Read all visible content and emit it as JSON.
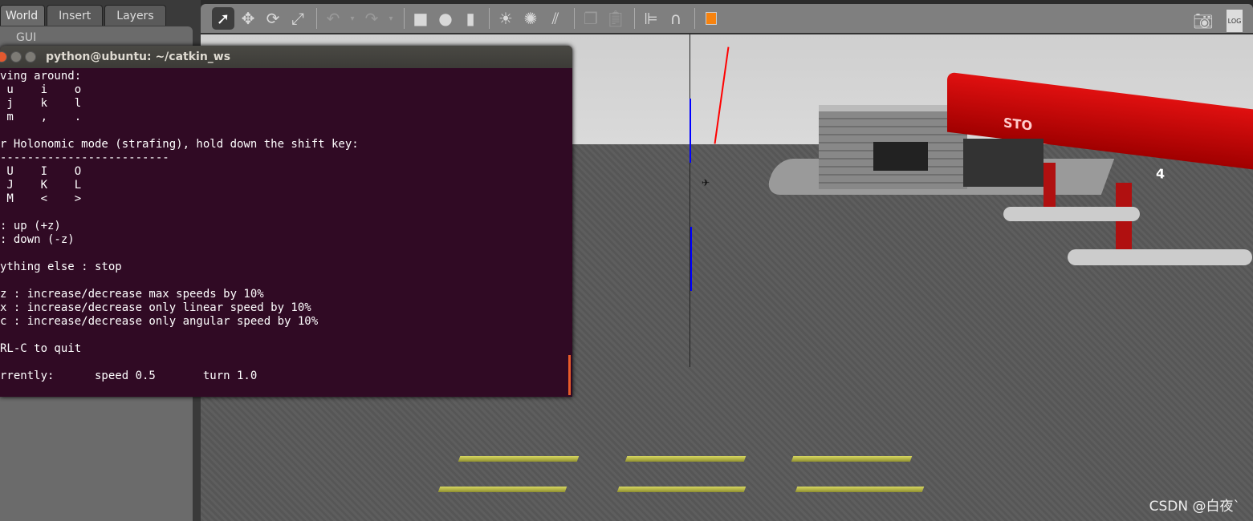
{
  "left_panel": {
    "tabs": [
      "World",
      "Insert",
      "Layers"
    ],
    "active_tab": "World",
    "items": [
      "GUI"
    ]
  },
  "toolbar": {
    "icons": [
      "select-arrow",
      "translate",
      "rotate",
      "scale",
      "undo",
      "undo-menu",
      "redo",
      "redo-menu",
      "box",
      "sphere",
      "cylinder",
      "point-light",
      "spot-light",
      "directional-light",
      "copy",
      "paste",
      "align",
      "magnet",
      "view-angle"
    ],
    "right_icons": [
      "screenshot",
      "log"
    ],
    "log_label": "LOG",
    "accent": "#f7830f"
  },
  "terminal": {
    "title": "python@ubuntu: ~/catkin_ws",
    "lines": [
      "ving around:",
      " u    i    o",
      " j    k    l",
      " m    ,    .",
      "",
      "r Holonomic mode (strafing), hold down the shift key:",
      "-------------------------",
      " U    I    O",
      " J    K    L",
      " M    <    >",
      "",
      ": up (+z)",
      ": down (-z)",
      "",
      "ything else : stop",
      "",
      "z : increase/decrease max speeds by 10%",
      "x : increase/decrease only linear speed by 10%",
      "c : increase/decrease only angular speed by 10%",
      "",
      "RL-C to quit",
      "",
      "rrently:      speed 0.5       turn 1.0"
    ]
  },
  "scene": {
    "sign_text": "STO",
    "pump_number": "4"
  },
  "watermark": "CSDN @白夜`"
}
